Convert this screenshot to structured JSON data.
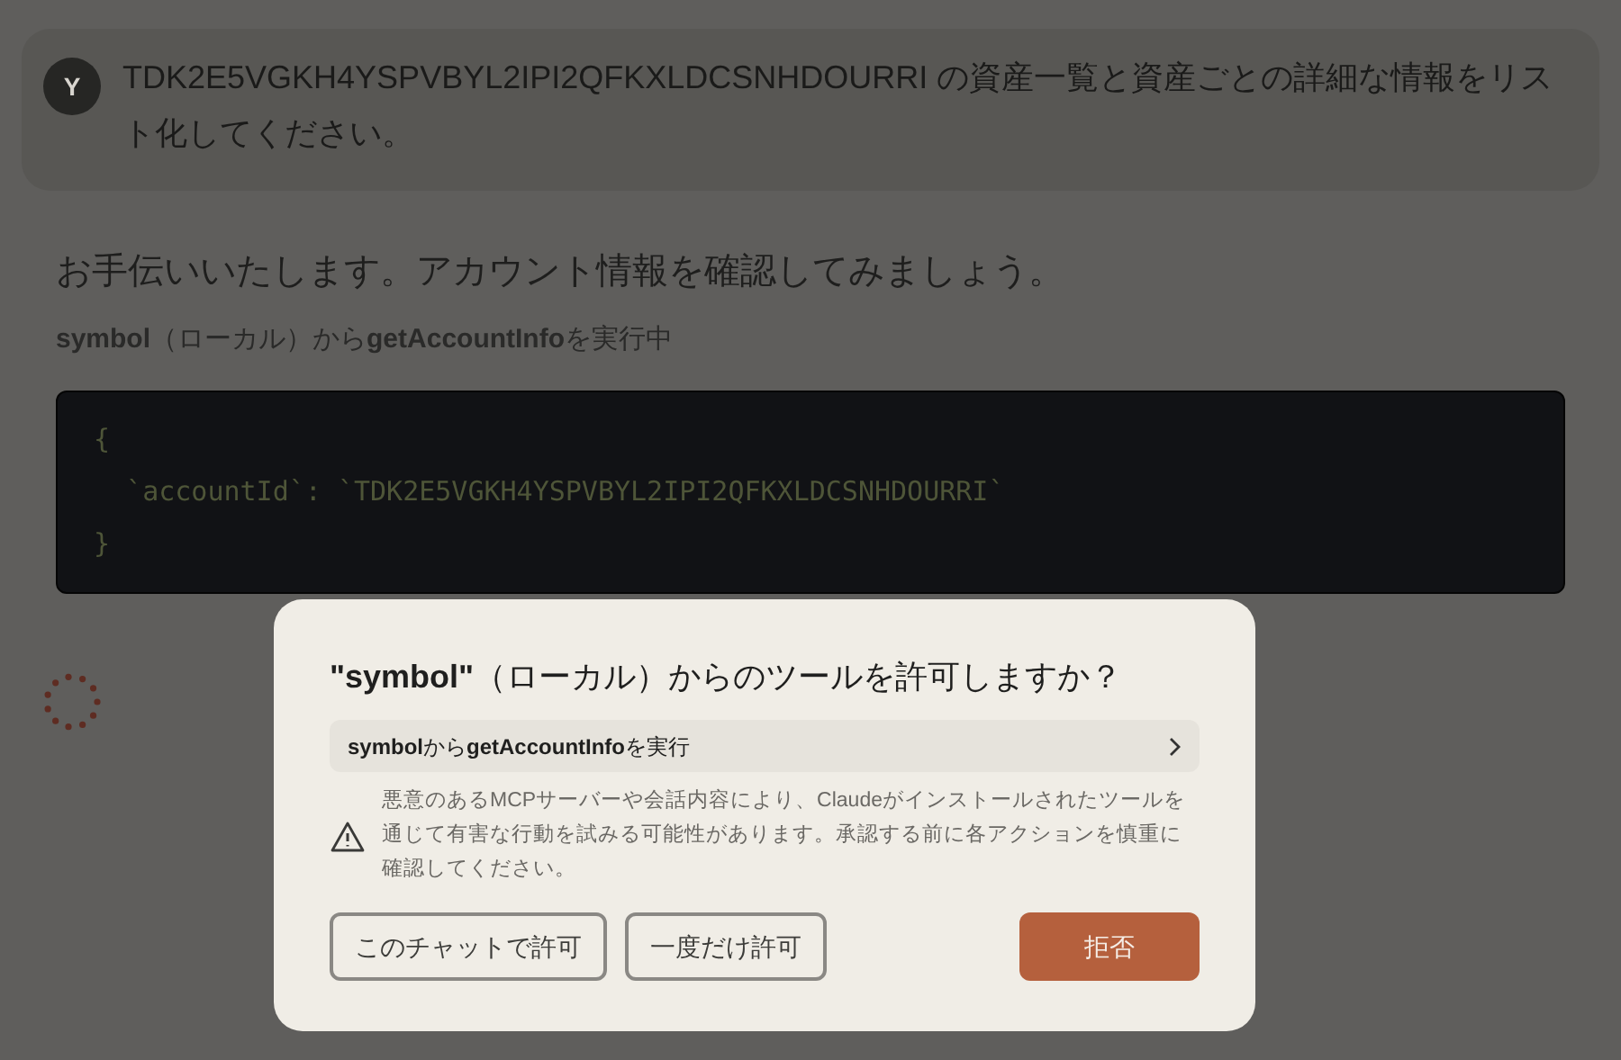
{
  "user_message": {
    "avatar": "Y",
    "text": "TDK2E5VGKH4YSPVBYL2IPI2QFKXLDCSNHDOURRI の資産一覧と資産ごとの詳細な情報をリスト化してください。"
  },
  "assistant": {
    "intro": "お手伝いいたします。アカウント情報を確認してみましょう。",
    "status": "**symbol**（ローカル）から**getAccountInfo**を実行中",
    "code_lines": [
      "{",
      "  `accountId`: `TDK2E5VGKH4YSPVBYL2IPI2QFKXLDCSNHDOURRI`",
      "}"
    ]
  },
  "dialog": {
    "title": "**\"symbol\"**（ローカル）からのツールを許可しますか？",
    "tool_row": "**symbol**から**getAccountInfo**を実行",
    "warning": "悪意のあるMCPサーバーや会話内容により、Claudeがインストールされたツールを通じて有害な行動を試みる可能性があります。承認する前に各アクションを慎重に確認してください。",
    "buttons": [
      {
        "label": "このチャットで許可",
        "kind": "outline"
      },
      {
        "label": "一度だけ許可",
        "kind": "outline"
      },
      {
        "label": "拒否",
        "kind": "primary"
      }
    ]
  }
}
